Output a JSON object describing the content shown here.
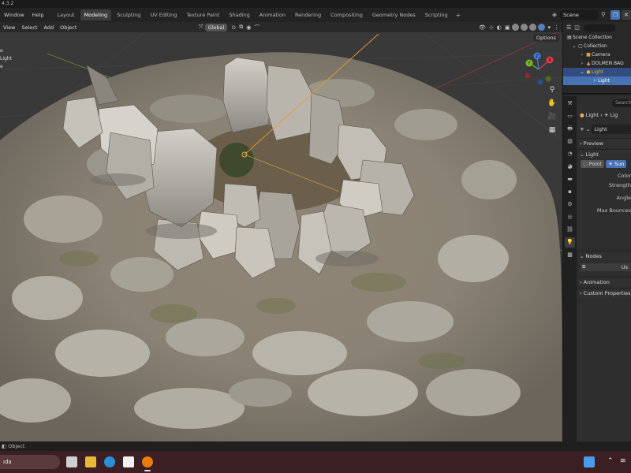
{
  "window": {
    "version": "4.3.2"
  },
  "topbar": {
    "menus": [
      "Window",
      "Help"
    ],
    "tabs": [
      "Layout",
      "Modeling",
      "Sculpting",
      "UV Editing",
      "Texture Paint",
      "Shading",
      "Animation",
      "Rendering",
      "Compositing",
      "Geometry Nodes",
      "Scripting"
    ],
    "active_tab": "Modeling",
    "add_tab": "+",
    "scene": "Scene"
  },
  "viewport": {
    "menus": [
      "View",
      "Select",
      "Add",
      "Object"
    ],
    "transform_orientation": "Global",
    "options_label": "Options",
    "left_labels": [
      "e",
      "Light",
      "e"
    ],
    "gizmo": {
      "x": "X",
      "y": "Y",
      "z": "Z"
    }
  },
  "outliner": {
    "scene_collection": "Scene Collection",
    "collection": "Collection",
    "items": [
      "Camera",
      "DOLMEN BAG",
      "Light"
    ],
    "child": "Light"
  },
  "properties": {
    "search_placeholder": "Search",
    "object_name": "Light",
    "data_name": "Light",
    "data_name_short": "Lig",
    "sections": {
      "preview": "Preview",
      "light": "Light",
      "nodes": "Nodes",
      "animation": "Animation",
      "custom": "Custom Properties"
    },
    "light_types": [
      "Point",
      "Sun"
    ],
    "active_type": "Sun",
    "fields": [
      "Color",
      "Strength",
      "Angle",
      "Max Bounces"
    ],
    "nodes_button": "Us"
  },
  "statusbar": {
    "mode": "Object"
  },
  "taskbar": {
    "search_text": "ıda"
  },
  "colors": {
    "accent": "#4772b3",
    "x_axis": "#e0374a",
    "y_axis": "#7ab828",
    "z_axis": "#3e7ee0",
    "light_orange": "#e8b04a"
  }
}
